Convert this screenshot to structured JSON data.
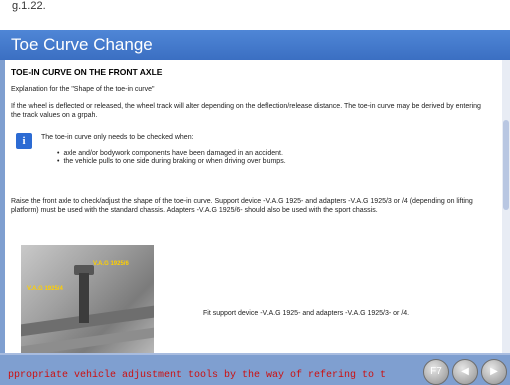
{
  "top_fragment": "g.1.22.",
  "window": {
    "title": "Toe Curve Change"
  },
  "section": {
    "heading": "TOE-IN CURVE ON THE FRONT AXLE",
    "explanation": "Explanation for the \"Shape of the toe-in curve\"",
    "para1": "If the wheel is deflected or released, the wheel track will alter depending on the deflection/release distance. The toe-in curve may be derived by entering the track values on a grpah.",
    "info_lead": "The toe-in curve only needs to be checked when:",
    "bullets": [
      "axle and/or bodywork components have been damaged in an accident.",
      "the vehicle pulls to one side during braking or when driving over bumps."
    ],
    "para2": "Raise the front axle to check/adjust the shape of the toe-in curve. Support device -V.A.G 1925- and adapters -V.A.G 1925/3 or /4 (depending on lifting platform) must be used with the standard chassis. Adapters -V.A.G 1925/6- should also be used with the sport chassis.",
    "photo_labels": [
      "V.A.G 1925/6",
      "V.A.G 1925/4"
    ],
    "fit_text": "Fit support device -V.A.G 1925- and adapters -V.A.G 1925/3- or /4."
  },
  "ticker": "ppropriate vehicle adjustment tools by the way of refering to t",
  "nav": {
    "prev": "F7",
    "back": "◀",
    "next": "▶"
  },
  "icons": {
    "info": "info-icon",
    "prev": "f7-button-icon",
    "back": "back-arrow-icon",
    "next": "forward-arrow-icon"
  }
}
